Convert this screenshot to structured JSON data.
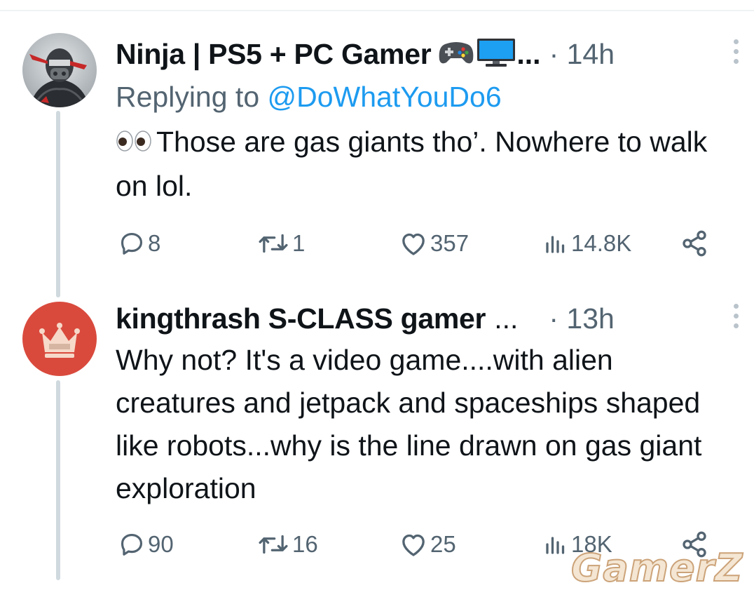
{
  "tweets": [
    {
      "display_name": "Ninja | PS5 + PC Gamer",
      "name_suffix": "...",
      "timestamp": "· 14h",
      "replying_prefix": "Replying to ",
      "replying_handle": "@DoWhatYouDo6",
      "text": "Those are gas giants tho’. Nowhere to walk on lol.",
      "leading_emoji": "eyes-emoji",
      "stats": {
        "replies": "8",
        "retweets": "1",
        "likes": "357",
        "views": "14.8K"
      }
    },
    {
      "display_name": "kingthrash S-CLASS gamer",
      "name_suffix": "...",
      "timestamp": "· 13h",
      "text": "Why not? It's a video game....with alien creatures and jetpack and spaceships shaped like robots...why is the line drawn on gas giant exploration",
      "stats": {
        "replies": "90",
        "retweets": "16",
        "likes": "25",
        "views": "18K"
      }
    }
  ],
  "watermark": "GamerZ",
  "colors": {
    "text": "#0f1419",
    "secondary": "#536471",
    "link": "#1d9bf0",
    "thread_line": "#cfd9de",
    "avatar_king_bg": "#d94a3d"
  },
  "icons": [
    "reply-icon",
    "retweet-icon",
    "like-icon",
    "views-icon",
    "share-icon",
    "more-icon"
  ]
}
